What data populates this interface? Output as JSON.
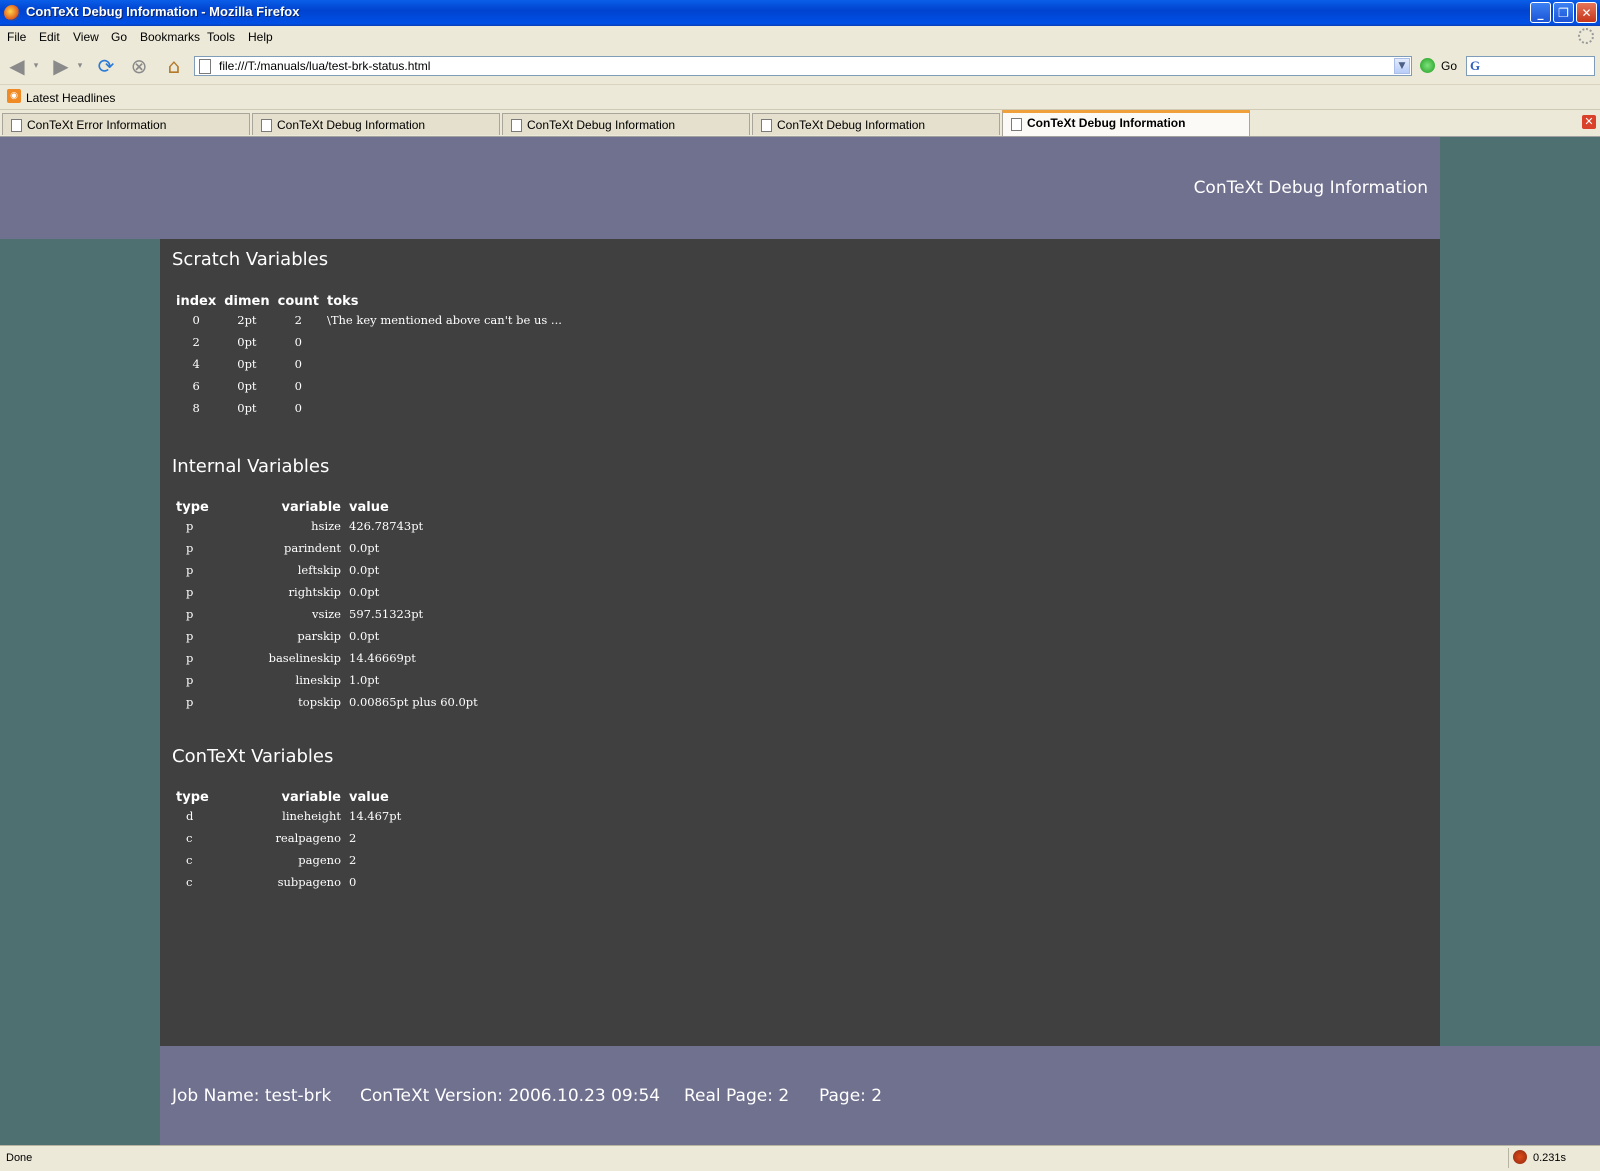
{
  "window": {
    "title": "ConTeXt Debug Information - Mozilla Firefox"
  },
  "menu": [
    "File",
    "Edit",
    "View",
    "Go",
    "Bookmarks",
    "Tools",
    "Help"
  ],
  "nav": {
    "url": "file:///T:/manuals/lua/test-brk-status.html",
    "go_label": "Go",
    "search_value": ""
  },
  "bookmarks": {
    "latest_headlines": "Latest Headlines"
  },
  "tabs": [
    {
      "label": "ConTeXt Error Information",
      "active": false
    },
    {
      "label": "ConTeXt Debug Information",
      "active": false
    },
    {
      "label": "ConTeXt Debug Information",
      "active": false
    },
    {
      "label": "ConTeXt Debug Information",
      "active": false
    },
    {
      "label": "ConTeXt Debug Information",
      "active": true
    }
  ],
  "page": {
    "header_title": "ConTeXt Debug Information",
    "scratch": {
      "heading": "Scratch Variables",
      "columns": [
        "index",
        "dimen",
        "count",
        "toks"
      ],
      "rows": [
        [
          "0",
          "2pt",
          "2",
          "\\The key mentioned above can't be us ..."
        ],
        [
          "2",
          "0pt",
          "0",
          ""
        ],
        [
          "4",
          "0pt",
          "0",
          ""
        ],
        [
          "6",
          "0pt",
          "0",
          ""
        ],
        [
          "8",
          "0pt",
          "0",
          ""
        ]
      ]
    },
    "internal": {
      "heading": "Internal Variables",
      "columns": [
        "type",
        "variable",
        "value"
      ],
      "rows": [
        [
          "p",
          "hsize",
          "426.78743pt"
        ],
        [
          "p",
          "parindent",
          "0.0pt"
        ],
        [
          "p",
          "leftskip",
          "0.0pt"
        ],
        [
          "p",
          "rightskip",
          "0.0pt"
        ],
        [
          "p",
          "vsize",
          "597.51323pt"
        ],
        [
          "p",
          "parskip",
          "0.0pt"
        ],
        [
          "p",
          "baselineskip",
          "14.46669pt"
        ],
        [
          "p",
          "lineskip",
          "1.0pt"
        ],
        [
          "p",
          "topskip",
          "0.00865pt plus 60.0pt"
        ]
      ]
    },
    "context": {
      "heading": "ConTeXt Variables",
      "columns": [
        "type",
        "variable",
        "value"
      ],
      "rows": [
        [
          "d",
          "lineheight",
          "14.467pt"
        ],
        [
          "c",
          "realpageno",
          "2"
        ],
        [
          "c",
          "pageno",
          "2"
        ],
        [
          "c",
          "subpageno",
          "0"
        ]
      ]
    },
    "footer": {
      "job_name": "Job Name: test-brk",
      "version": "ConTeXt Version: 2006.10.23 09:54",
      "real_page": "Real Page: 2",
      "page": "Page: 2"
    }
  },
  "status": {
    "text": "Done",
    "timing": "0.231s"
  },
  "colors": {
    "header": "#70708f",
    "main": "#404040",
    "side": "#4f7070"
  }
}
